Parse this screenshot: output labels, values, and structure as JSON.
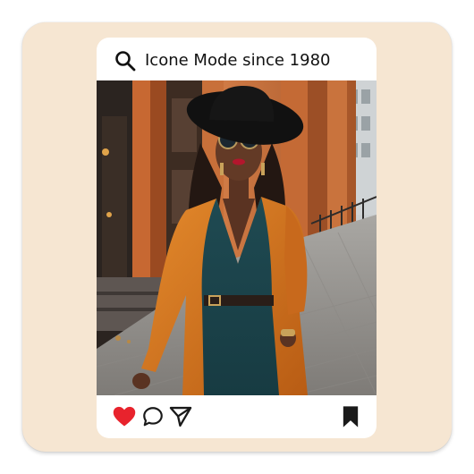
{
  "post": {
    "search_query": "Icone Mode since 1980",
    "image_alt": "Fashion photo of a woman in an orange coat, teal jumpsuit and black wide-brim hat walking on a city sidewalk"
  },
  "actions": {
    "like_icon": "heart-icon",
    "comment_icon": "comment-icon",
    "share_icon": "send-icon",
    "save_icon": "bookmark-icon"
  },
  "colors": {
    "sticker_background": "#f6e6d2",
    "card_background": "#ffffff",
    "like_color": "#e8232d",
    "icon_color": "#1a1a1a"
  }
}
